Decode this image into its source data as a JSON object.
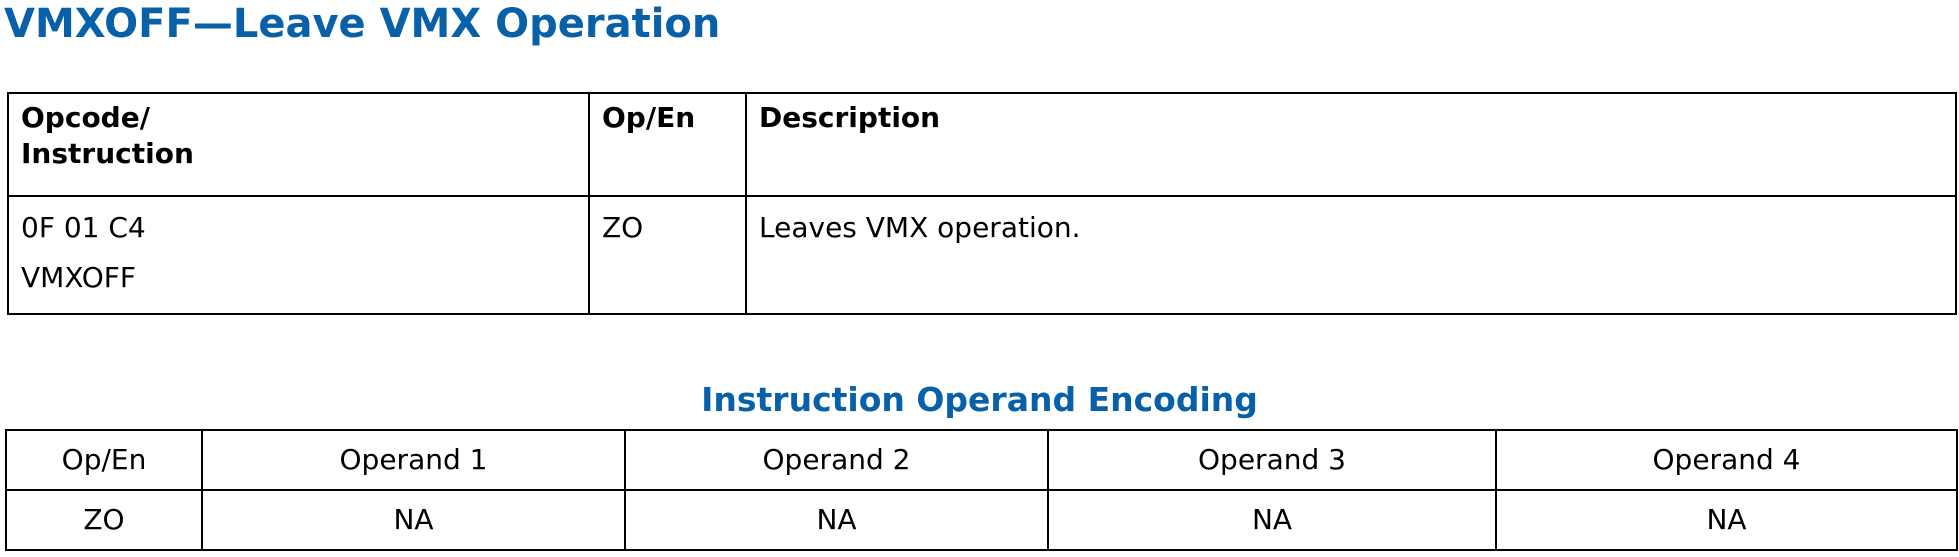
{
  "page": {
    "title": "VMXOFF—Leave VMX Operation"
  },
  "summary_table": {
    "headers": {
      "opcode": "Opcode/",
      "opcode_line2": "Instruction",
      "op_en": "Op/En",
      "description": "Description"
    },
    "rows": [
      {
        "opcode": "0F 01 C4",
        "instruction": "VMXOFF",
        "op_en": "ZO",
        "description": "Leaves VMX operation."
      }
    ]
  },
  "encoding": {
    "heading": "Instruction Operand Encoding",
    "headers": [
      "Op/En",
      "Operand 1",
      "Operand 2",
      "Operand 3",
      "Operand 4"
    ],
    "rows": [
      [
        "ZO",
        "NA",
        "NA",
        "NA",
        "NA"
      ]
    ]
  },
  "colors": {
    "heading_blue": "#0860a8",
    "border": "#000000",
    "text": "#000000"
  }
}
